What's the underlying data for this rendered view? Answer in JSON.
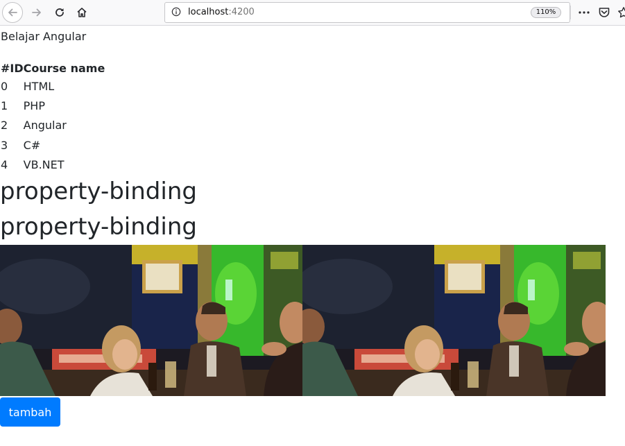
{
  "browser": {
    "url_host": "localhost",
    "url_port": ":4200",
    "zoom": "110%"
  },
  "page": {
    "title": "Belajar Angular",
    "table": {
      "headers": [
        "#ID",
        "Course name"
      ],
      "rows": [
        [
          "0",
          "HTML"
        ],
        [
          "1",
          "PHP"
        ],
        [
          "2",
          "Angular"
        ],
        [
          "3",
          "C#"
        ],
        [
          "4",
          "VB.NET"
        ]
      ]
    },
    "headings": [
      "property-binding",
      "property-binding"
    ],
    "button_label": "tambah",
    "accent_color": "#007bff"
  }
}
